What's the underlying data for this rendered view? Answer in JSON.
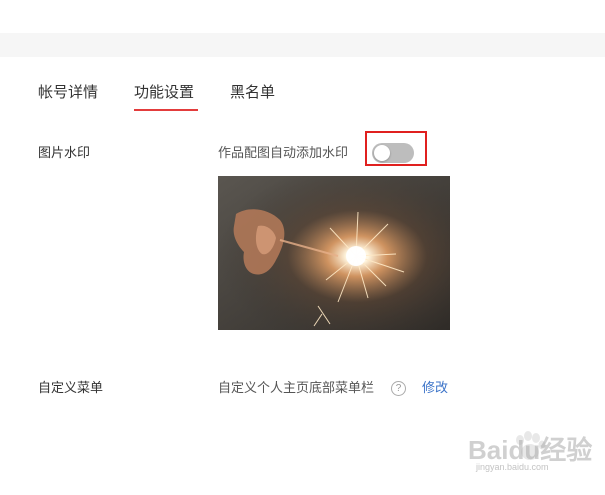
{
  "tabs": [
    {
      "label": "帐号详情",
      "active": false
    },
    {
      "label": "功能设置",
      "active": true
    },
    {
      "label": "黑名单",
      "active": false
    }
  ],
  "watermark_setting": {
    "label": "图片水印",
    "description": "作品配图自动添加水印",
    "toggle_on": false
  },
  "menu_setting": {
    "label": "自定义菜单",
    "description": "自定义个人主页底部菜单栏",
    "help_glyph": "?",
    "edit_link": "修改"
  },
  "colors": {
    "accent_underline": "#e33c3c",
    "highlight_box": "#e0201f",
    "link": "#3b73c8",
    "toggle_off": "#bdbdbd"
  },
  "logo_watermark": {
    "text": "Baidu经验",
    "sub": "jingyan.baidu.com"
  },
  "icons": [
    "help-icon",
    "toggle-switch",
    "baidu-paw-logo"
  ]
}
